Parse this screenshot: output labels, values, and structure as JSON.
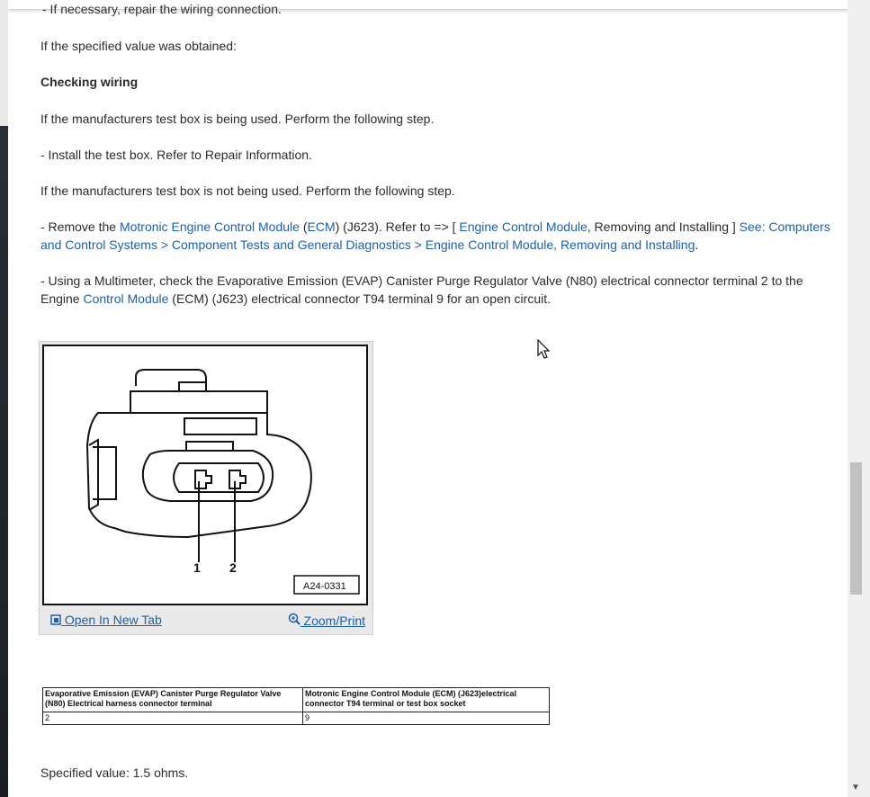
{
  "top": {
    "fragment": "-  If necessary, repair the wiring connection."
  },
  "content": {
    "p1": "If the specified value was obtained:",
    "heading": "Checking wiring",
    "p2": "If the manufacturers test box is being used. Perform the following step.",
    "p3": "-  Install the test box. Refer to Repair Information.",
    "p4": "If the manufacturers test box is not being used. Perform the following step.",
    "p5": {
      "t1": "-  Remove the ",
      "l1": "Motronic Engine Control Module",
      "t2": " (",
      "l2": "ECM",
      "t3": ") (J623). Refer to => [ ",
      "l3": "Engine Control Module",
      "t4": ", Removing and Installing ] ",
      "l4": "See: Computers and Control Systems > Component Tests and General Diagnostics > Engine Control Module, Removing and Installing",
      "t5": "."
    },
    "p6": {
      "t1": "-  Using a Multimeter, check the Evaporative Emission (EVAP) Canister Purge Regulator Valve (N80) electrical connector terminal 2 to the Engine ",
      "l1": "Control Module",
      "t2": " (ECM) (J623) electrical connector T94 terminal 9 for an open circuit."
    },
    "specified": "Specified value: 1.5 ohms."
  },
  "figure": {
    "code": "A24-0331",
    "pin1": "1",
    "pin2": "2",
    "open_tab": "Open In New Tab",
    "zoom": "Zoom/Print",
    "icons": [
      "open-tab-icon",
      "zoom-icon"
    ]
  },
  "table": {
    "headers": [
      "Evaporative Emission (EVAP) Canister Purge Regulator Valve (N80) Electrical harness connector terminal",
      "Motronic Engine Control Module (ECM) (J623)electrical connector T94 terminal or test box socket"
    ],
    "rows": [
      [
        "2",
        "9"
      ]
    ]
  },
  "colors": {
    "link": "#1f5fa8",
    "text": "#2b2b2b"
  }
}
